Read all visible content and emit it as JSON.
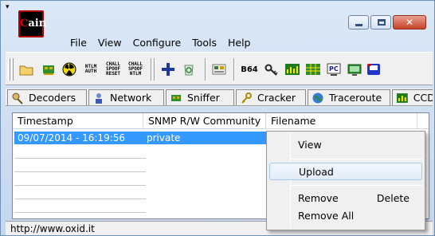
{
  "app": {
    "logo_text": "Cain",
    "sysmenu_glyph": "▾"
  },
  "menubar": [
    {
      "label": "File"
    },
    {
      "label": "View"
    },
    {
      "label": "Configure"
    },
    {
      "label": "Tools"
    },
    {
      "label": "Help"
    }
  ],
  "toolbar": {
    "ntlm_auth": "NTLM AUTH",
    "chall_spoof_reset": "CHALL SPOOF RESET",
    "chall_spoof_ntlm": "CHALL SPOOF NTLM",
    "b64": "B64"
  },
  "tabs": [
    {
      "label": "Decoders"
    },
    {
      "label": "Network"
    },
    {
      "label": "Sniffer"
    },
    {
      "label": "Cracker"
    },
    {
      "label": "Traceroute"
    },
    {
      "label": "CCDU"
    }
  ],
  "table": {
    "columns": [
      "Timestamp",
      "SNMP R/W Community",
      "Filename"
    ],
    "rows": [
      {
        "timestamp": "09/07/2014 - 16:19:56",
        "community": "private",
        "filename": ""
      }
    ]
  },
  "context_menu": {
    "items": [
      {
        "label": "View",
        "shortcut": ""
      },
      {
        "label": "Upload",
        "shortcut": ""
      },
      {
        "label": "Remove",
        "shortcut": "Delete"
      },
      {
        "label": "Remove All",
        "shortcut": ""
      }
    ]
  },
  "status": {
    "url": "http://www.oxid.it"
  },
  "colors": {
    "selection": "#3399ff",
    "accent_red": "#e00000",
    "frame": "#c9d9ee"
  }
}
